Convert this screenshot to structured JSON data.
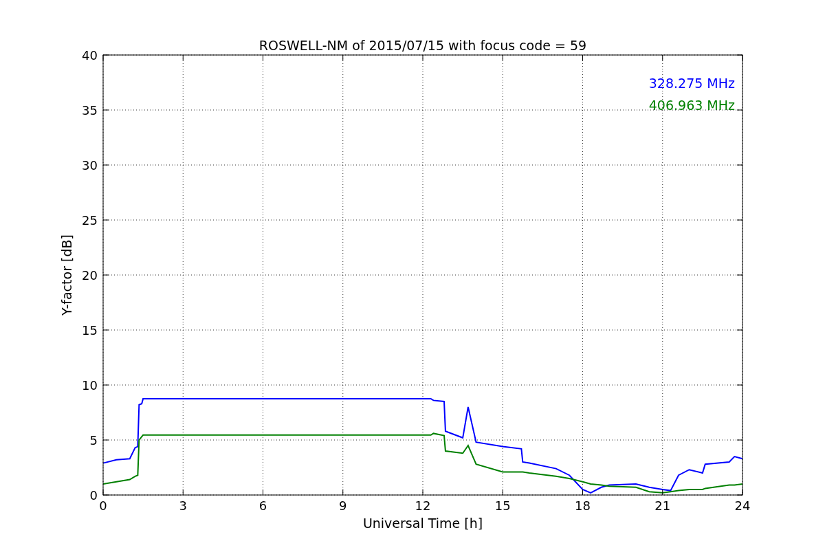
{
  "chart_data": {
    "type": "line",
    "title": "ROSWELL-NM of 2015/07/15 with focus code = 59",
    "xlabel": "Universal Time [h]",
    "ylabel": "Y-factor [dB]",
    "x": [
      0,
      0.5,
      1,
      1.2,
      1.3,
      1.35,
      1.45,
      1.5,
      12.3,
      12.4,
      12.8,
      12.85,
      13.5,
      13.7,
      14,
      15,
      15.7,
      15.75,
      16,
      17,
      17.5,
      18,
      18.3,
      18.7,
      19,
      20,
      20.5,
      21,
      21.3,
      21.6,
      22,
      22.5,
      22.6,
      23.5,
      23.7,
      24
    ],
    "series": [
      {
        "name": "328.275 MHz",
        "color": "#0000ff",
        "values": [
          2.9,
          3.2,
          3.3,
          4.3,
          4.4,
          8.2,
          8.3,
          8.75,
          8.75,
          8.6,
          8.5,
          5.8,
          5.2,
          8.0,
          4.8,
          4.4,
          4.2,
          3.0,
          2.9,
          2.4,
          1.8,
          0.5,
          0.2,
          0.7,
          0.9,
          1.0,
          0.7,
          0.5,
          0.4,
          1.8,
          2.3,
          2.0,
          2.8,
          3.0,
          3.5,
          3.3
        ]
      },
      {
        "name": "406.963 MHz",
        "color": "#008000",
        "values": [
          1.0,
          1.2,
          1.4,
          1.7,
          1.8,
          5.0,
          5.3,
          5.45,
          5.45,
          5.6,
          5.4,
          4.0,
          3.8,
          4.5,
          2.8,
          2.1,
          2.1,
          2.1,
          2.0,
          1.7,
          1.5,
          1.2,
          1.0,
          0.9,
          0.8,
          0.7,
          0.3,
          0.2,
          0.3,
          0.4,
          0.5,
          0.5,
          0.6,
          0.9,
          0.9,
          1.0
        ]
      }
    ],
    "grid": true,
    "xlim": [
      0,
      24
    ],
    "ylim": [
      0,
      40
    ],
    "xticks": [
      0,
      3,
      6,
      9,
      12,
      15,
      18,
      21,
      24
    ],
    "yticks": [
      0,
      5,
      10,
      15,
      20,
      25,
      30,
      35,
      40
    ]
  }
}
